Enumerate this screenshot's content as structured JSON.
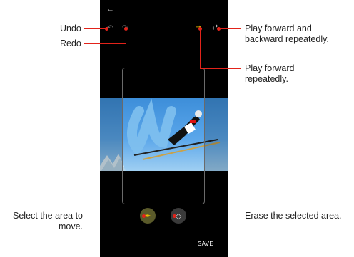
{
  "callouts": {
    "undo": "Undo",
    "redo": "Redo",
    "play_loop": "Play forward and backward repeatedly.",
    "play_forward": "Play forward repeatedly.",
    "select_area": "Select the area to move.",
    "erase_area": "Erase the selected area."
  },
  "phone": {
    "save_label": "SAVE"
  },
  "icons": {
    "back": "back-arrow-icon",
    "undo": "undo-icon",
    "redo": "redo-icon",
    "play_forward": "play-forward-icon",
    "play_loop": "play-loop-icon",
    "select": "brush-icon",
    "erase": "eraser-icon"
  },
  "colors": {
    "callout_line": "#e2231a",
    "accent": "#f2c200",
    "screen_bg": "#000000"
  }
}
